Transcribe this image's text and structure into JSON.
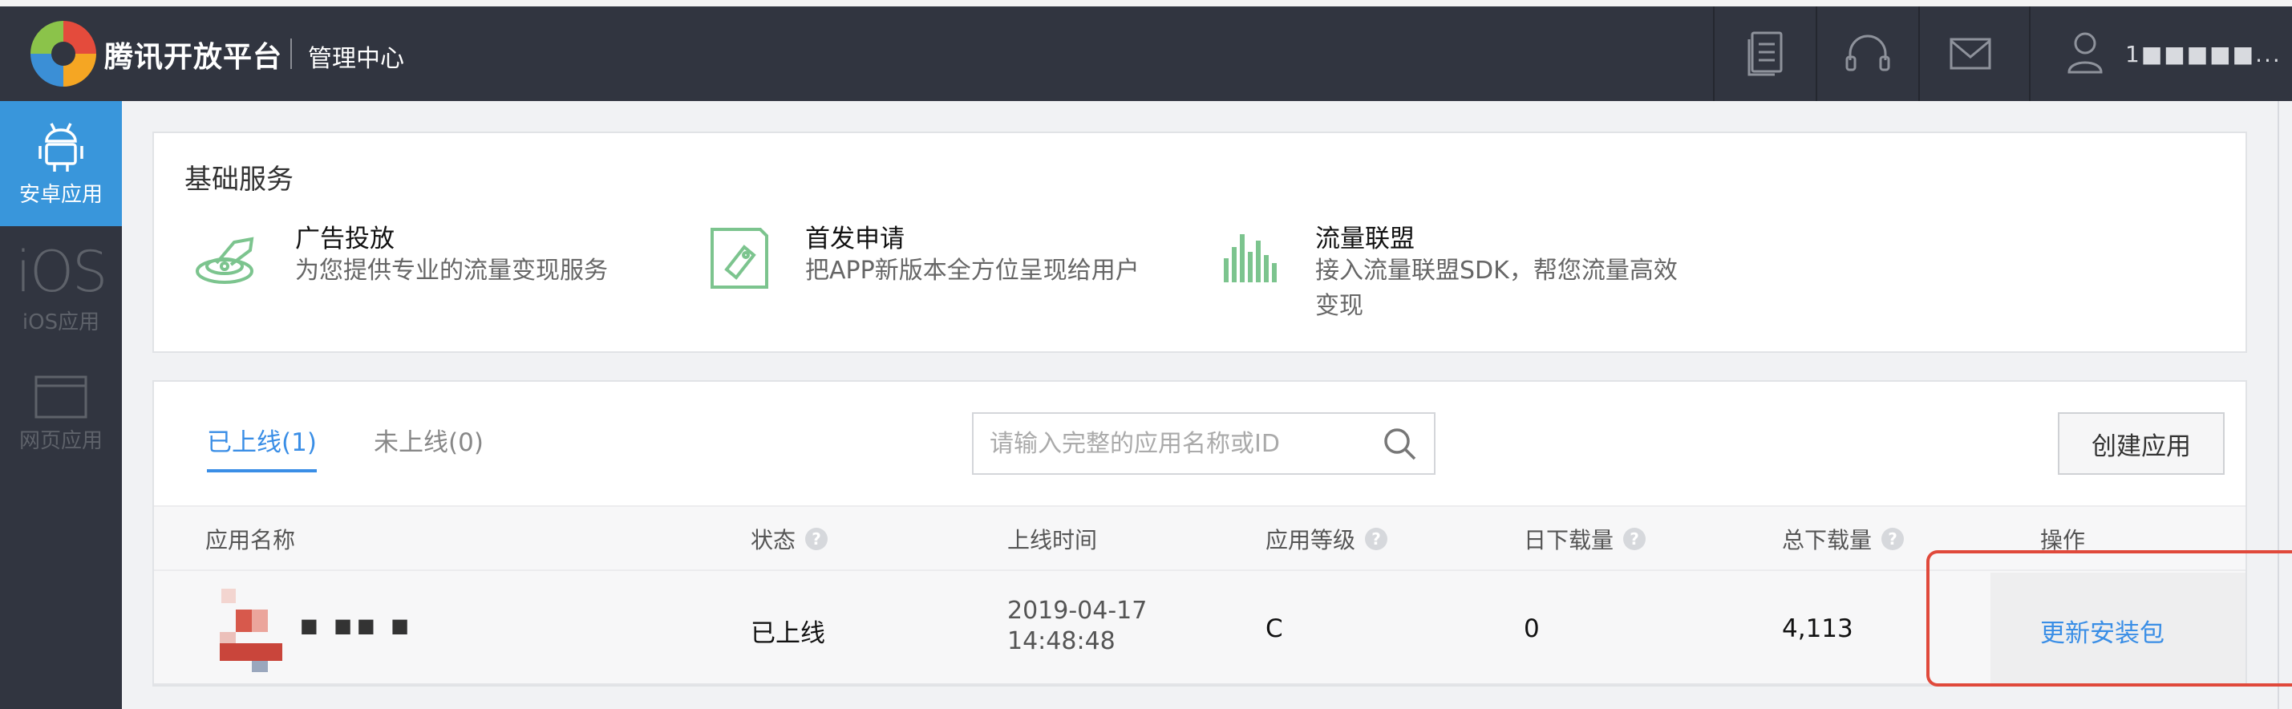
{
  "header": {
    "brand": "腾讯开放平台",
    "subtitle": "管理中心",
    "icons": [
      "document-icon",
      "headset-icon",
      "mail-icon",
      "user-icon"
    ],
    "user_name": "1■■■■■..."
  },
  "sidebar": {
    "items": [
      {
        "label": "安卓应用",
        "icon": "android-icon",
        "active": true
      },
      {
        "label": "iOS应用",
        "icon": "ios-icon",
        "glyph": "iOS",
        "active": false
      },
      {
        "label": "网页应用",
        "icon": "browser-window-icon",
        "active": false
      }
    ]
  },
  "services": {
    "title": "基础服务",
    "items": [
      {
        "name": "广告投放",
        "desc": "为您提供专业的流量变现服务",
        "icon": "ad-delivery-icon"
      },
      {
        "name": "首发申请",
        "desc": "把APP新版本全方位呈现给用户",
        "icon": "tag-icon"
      },
      {
        "name": "流量联盟",
        "desc_line1": "接入流量联盟SDK，帮您流量高效",
        "desc_line2": "变现",
        "icon": "bar-chart-icon"
      }
    ]
  },
  "apps": {
    "tabs": [
      {
        "label": "已上线(1)",
        "active": true
      },
      {
        "label": "未上线(0)",
        "active": false
      }
    ],
    "search_placeholder": "请输入完整的应用名称或ID",
    "create_label": "创建应用",
    "columns": [
      "应用名称",
      "状态",
      "上线时间",
      "应用等级",
      "日下载量",
      "总下载量",
      "操作"
    ],
    "rows": [
      {
        "name": "■ ■■ ■",
        "status": "已上线",
        "date": "2019-04-17",
        "time": "14:48:48",
        "grade": "C",
        "daily": "0",
        "total": "4,113",
        "action": "更新安装包"
      }
    ]
  },
  "colors": {
    "topbar": "#313540",
    "accent": "#3a8ee6",
    "sidebar_active": "#3996db",
    "service_icon": "#7cc48e",
    "highlight": "#e0493b"
  }
}
